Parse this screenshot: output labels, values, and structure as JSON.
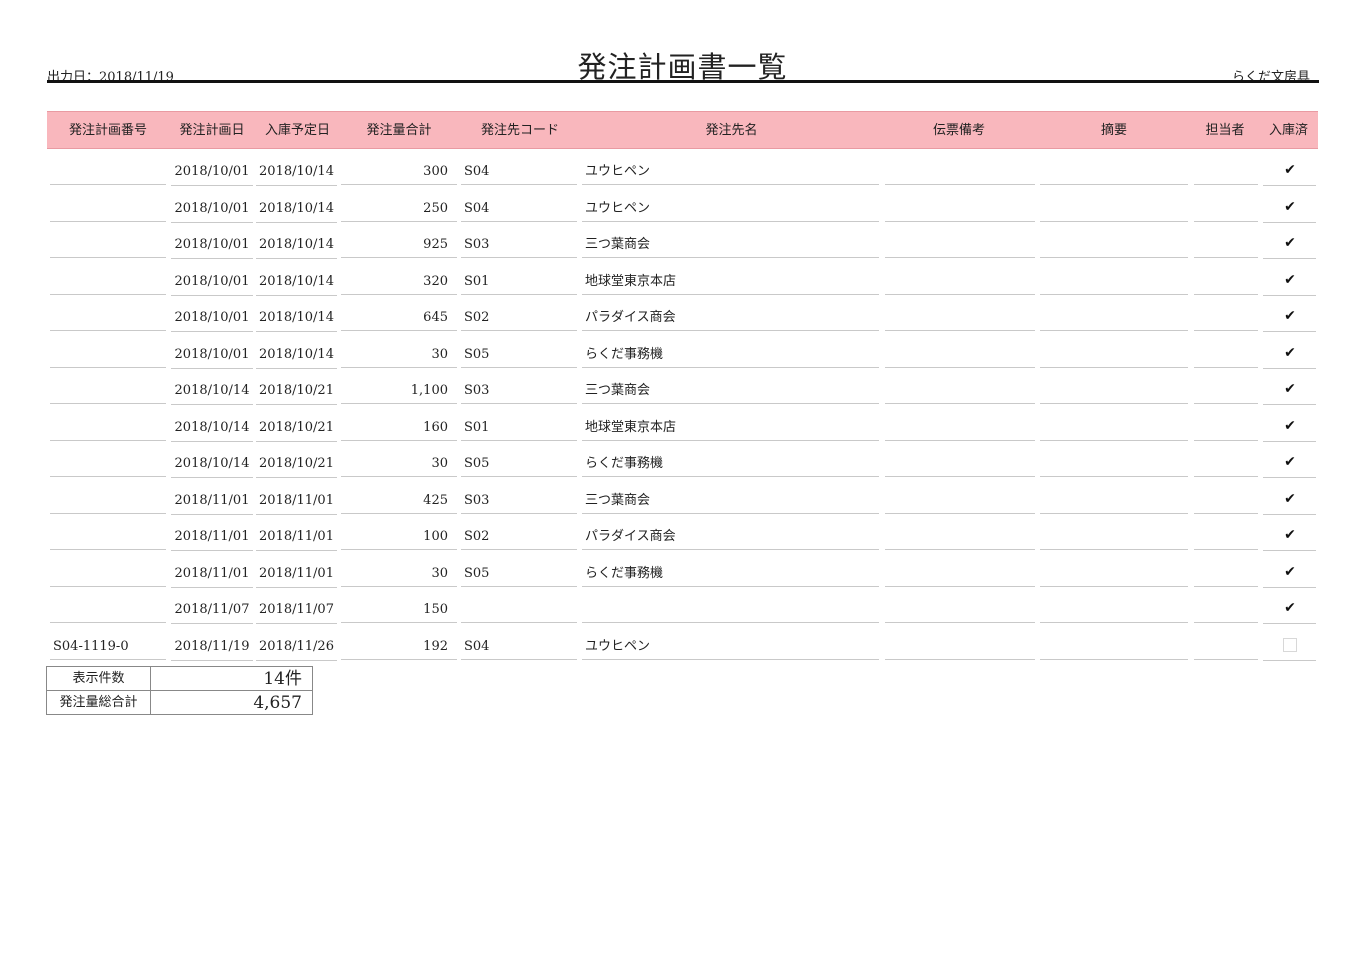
{
  "header": {
    "output_date": "出力日：2018/11/19",
    "title": "発注計画書一覧",
    "company": "らくだ文房具"
  },
  "table": {
    "columns": [
      "発注計画番号",
      "発注計画日",
      "入庫予定日",
      "発注量合計",
      "発注先コード",
      "発注先名",
      "伝票備考",
      "摘要",
      "担当者",
      "入庫済"
    ],
    "rows": [
      {
        "no": "",
        "plan_date": "2018/10/01",
        "arrival_date": "2018/10/14",
        "qty": "300",
        "code": "S04",
        "name": "ユウヒペン",
        "note": "",
        "memo": "",
        "staff": "",
        "received": true
      },
      {
        "no": "",
        "plan_date": "2018/10/01",
        "arrival_date": "2018/10/14",
        "qty": "250",
        "code": "S04",
        "name": "ユウヒペン",
        "note": "",
        "memo": "",
        "staff": "",
        "received": true
      },
      {
        "no": "",
        "plan_date": "2018/10/01",
        "arrival_date": "2018/10/14",
        "qty": "925",
        "code": "S03",
        "name": "三つ葉商会",
        "note": "",
        "memo": "",
        "staff": "",
        "received": true
      },
      {
        "no": "",
        "plan_date": "2018/10/01",
        "arrival_date": "2018/10/14",
        "qty": "320",
        "code": "S01",
        "name": "地球堂東京本店",
        "note": "",
        "memo": "",
        "staff": "",
        "received": true
      },
      {
        "no": "",
        "plan_date": "2018/10/01",
        "arrival_date": "2018/10/14",
        "qty": "645",
        "code": "S02",
        "name": "パラダイス商会",
        "note": "",
        "memo": "",
        "staff": "",
        "received": true
      },
      {
        "no": "",
        "plan_date": "2018/10/01",
        "arrival_date": "2018/10/14",
        "qty": "30",
        "code": "S05",
        "name": "らくだ事務機",
        "note": "",
        "memo": "",
        "staff": "",
        "received": true
      },
      {
        "no": "",
        "plan_date": "2018/10/14",
        "arrival_date": "2018/10/21",
        "qty": "1,100",
        "code": "S03",
        "name": "三つ葉商会",
        "note": "",
        "memo": "",
        "staff": "",
        "received": true
      },
      {
        "no": "",
        "plan_date": "2018/10/14",
        "arrival_date": "2018/10/21",
        "qty": "160",
        "code": "S01",
        "name": "地球堂東京本店",
        "note": "",
        "memo": "",
        "staff": "",
        "received": true
      },
      {
        "no": "",
        "plan_date": "2018/10/14",
        "arrival_date": "2018/10/21",
        "qty": "30",
        "code": "S05",
        "name": "らくだ事務機",
        "note": "",
        "memo": "",
        "staff": "",
        "received": true
      },
      {
        "no": "",
        "plan_date": "2018/11/01",
        "arrival_date": "2018/11/01",
        "qty": "425",
        "code": "S03",
        "name": "三つ葉商会",
        "note": "",
        "memo": "",
        "staff": "",
        "received": true
      },
      {
        "no": "",
        "plan_date": "2018/11/01",
        "arrival_date": "2018/11/01",
        "qty": "100",
        "code": "S02",
        "name": "パラダイス商会",
        "note": "",
        "memo": "",
        "staff": "",
        "received": true
      },
      {
        "no": "",
        "plan_date": "2018/11/01",
        "arrival_date": "2018/11/01",
        "qty": "30",
        "code": "S05",
        "name": "らくだ事務機",
        "note": "",
        "memo": "",
        "staff": "",
        "received": true
      },
      {
        "no": "",
        "plan_date": "2018/11/07",
        "arrival_date": "2018/11/07",
        "qty": "150",
        "code": "",
        "name": "",
        "note": "",
        "memo": "",
        "staff": "",
        "received": true
      },
      {
        "no": "S04-1119-0",
        "plan_date": "2018/11/19",
        "arrival_date": "2018/11/26",
        "qty": "192",
        "code": "S04",
        "name": "ユウヒペン",
        "note": "",
        "memo": "",
        "staff": "",
        "received": false
      }
    ]
  },
  "summary": {
    "count_label": "表示件数",
    "count_value": "14件",
    "total_label": "発注量総合計",
    "total_value": "4,657"
  },
  "icons": {
    "checked": "check-icon",
    "unchecked": "empty-checkbox-icon"
  }
}
